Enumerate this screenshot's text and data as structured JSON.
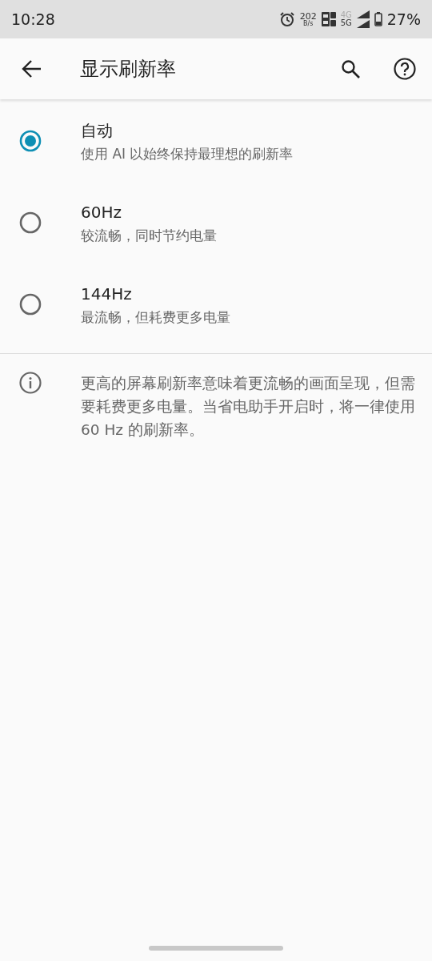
{
  "status_bar": {
    "time": "10:28",
    "speed": "202",
    "speed_unit": "B/s",
    "network_top": "4G",
    "network_bottom": "5G",
    "battery": "27%"
  },
  "app_bar": {
    "title": "显示刷新率"
  },
  "options": [
    {
      "label": "自动",
      "description": "使用 AI 以始终保持最理想的刷新率",
      "selected": true
    },
    {
      "label": "60Hz",
      "description": "较流畅，同时节约电量",
      "selected": false
    },
    {
      "label": "144Hz",
      "description": "最流畅，但耗费更多电量",
      "selected": false
    }
  ],
  "info": "更高的屏幕刷新率意味着更流畅的画面呈现，但需要耗费更多电量。当省电助手开启时，将一律使用 60 Hz 的刷新率。"
}
